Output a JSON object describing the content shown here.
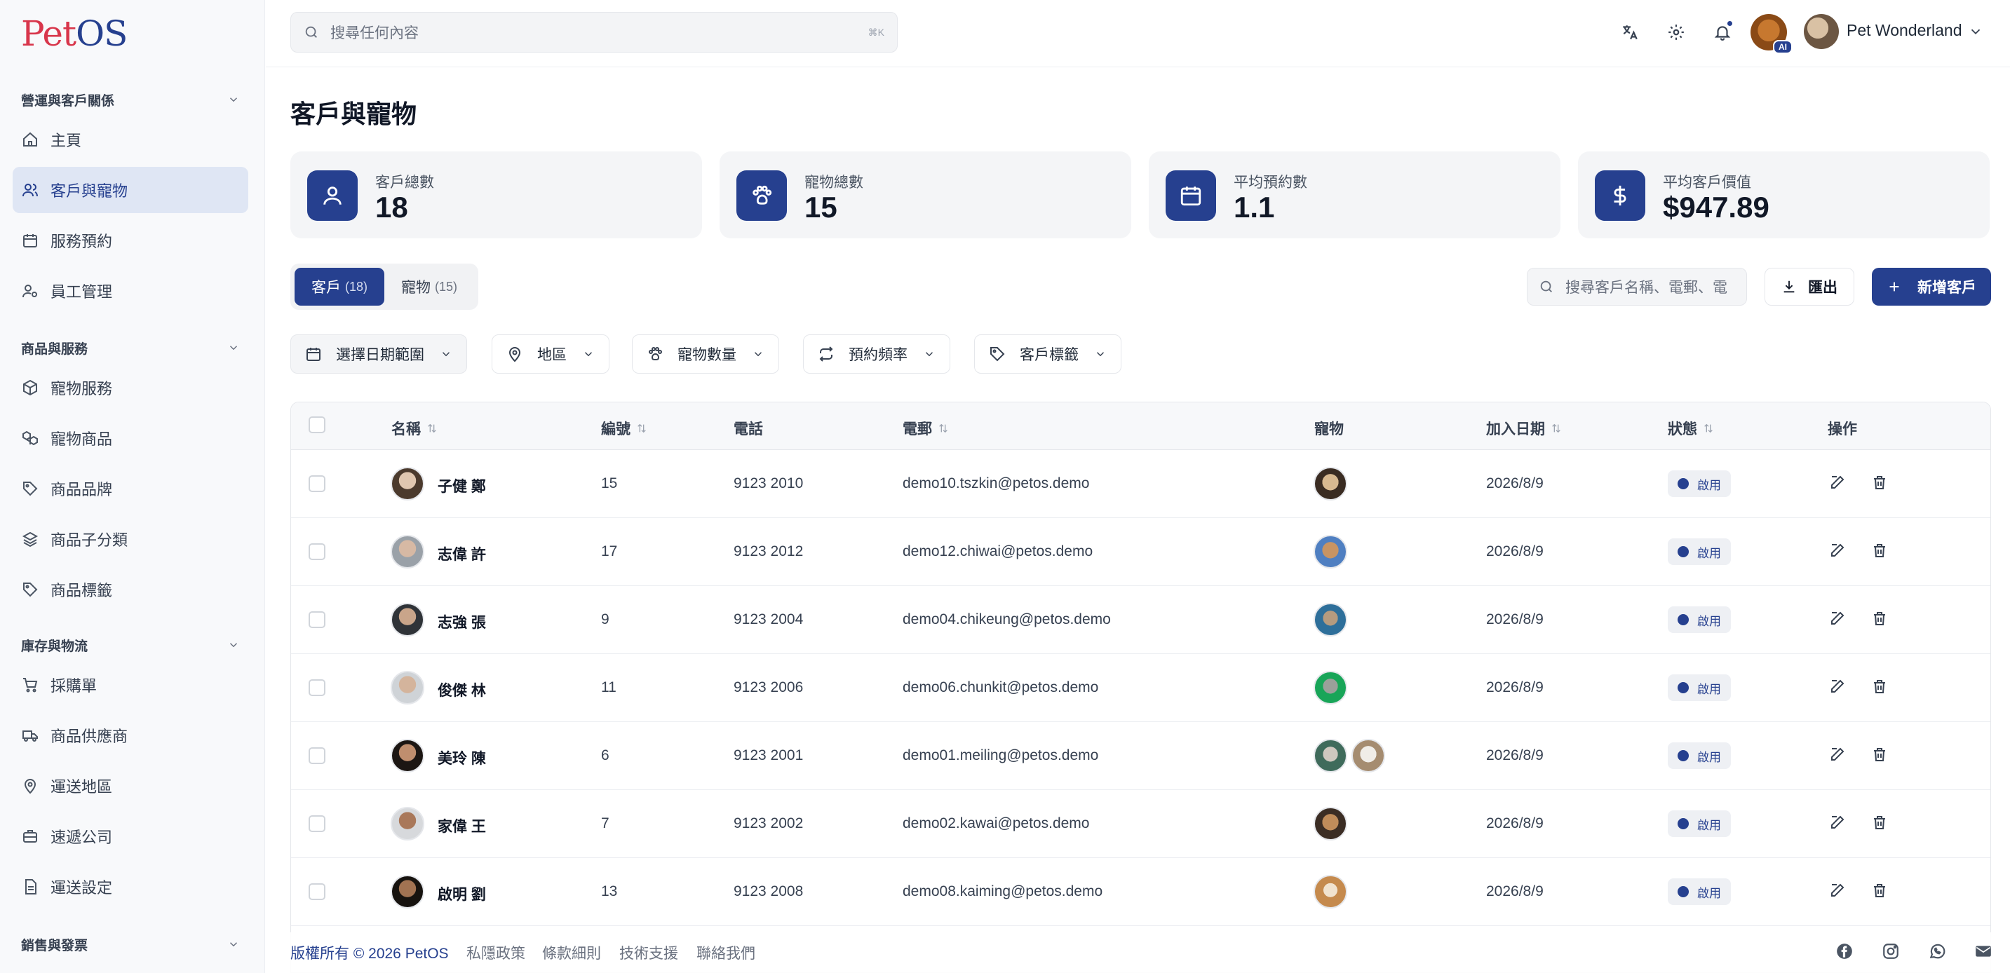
{
  "app": {
    "logo_pet": "Pet",
    "logo_os": "OS"
  },
  "sidebar": {
    "groups": [
      {
        "label": "營運與客戶關係",
        "items": [
          {
            "label": "主頁",
            "icon": "home-icon"
          },
          {
            "label": "客戶與寵物",
            "icon": "users-icon",
            "active": true
          },
          {
            "label": "服務預約",
            "icon": "calendar-icon"
          },
          {
            "label": "員工管理",
            "icon": "user-cog-icon"
          }
        ]
      },
      {
        "label": "商品與服務",
        "items": [
          {
            "label": "寵物服務",
            "icon": "package-icon"
          },
          {
            "label": "寵物商品",
            "icon": "boxes-icon"
          },
          {
            "label": "商品品牌",
            "icon": "tag-icon"
          },
          {
            "label": "商品子分類",
            "icon": "layers-icon"
          },
          {
            "label": "商品標籤",
            "icon": "tags-icon"
          }
        ]
      },
      {
        "label": "庫存與物流",
        "items": [
          {
            "label": "採購單",
            "icon": "cart-icon"
          },
          {
            "label": "商品供應商",
            "icon": "truck-icon"
          },
          {
            "label": "運送地區",
            "icon": "map-pin-icon"
          },
          {
            "label": "速遞公司",
            "icon": "briefcase-icon"
          },
          {
            "label": "運送設定",
            "icon": "file-settings-icon"
          }
        ]
      },
      {
        "label": "銷售與發票",
        "items": []
      }
    ]
  },
  "topbar": {
    "search_placeholder": "搜尋任何內容",
    "search_shortcut": "⌘K",
    "ai_badge": "AI",
    "user_name": "Pet Wonderland"
  },
  "page": {
    "title": "客戶與寵物"
  },
  "stats": [
    {
      "label": "客戶總數",
      "value": "18",
      "icon": "user-icon"
    },
    {
      "label": "寵物總數",
      "value": "15",
      "icon": "paw-icon"
    },
    {
      "label": "平均預約數",
      "value": "1.1",
      "icon": "calendar-icon"
    },
    {
      "label": "平均客戶價值",
      "value": "$947.89",
      "icon": "dollar-icon"
    }
  ],
  "tabs": [
    {
      "label": "客戶",
      "count": "(18)",
      "active": true
    },
    {
      "label": "寵物",
      "count": "(15)",
      "active": false
    }
  ],
  "customer_search_placeholder": "搜尋客戶名稱、電郵、電",
  "buttons": {
    "export": "匯出",
    "add_customer": "新增客戶"
  },
  "filters": [
    {
      "label": "選擇日期範圍",
      "icon": "calendar-icon"
    },
    {
      "label": "地區",
      "icon": "map-pin-icon"
    },
    {
      "label": "寵物數量",
      "icon": "paw-icon"
    },
    {
      "label": "預約頻率",
      "icon": "repeat-icon"
    },
    {
      "label": "客戶標籤",
      "icon": "tag-icon"
    }
  ],
  "table": {
    "headers": {
      "name": "名稱",
      "id": "編號",
      "phone": "電話",
      "email": "電郵",
      "pets": "寵物",
      "joined": "加入日期",
      "status": "狀態",
      "actions": "操作"
    },
    "rows": [
      {
        "name": "子健 鄭",
        "id": "15",
        "phone": "9123 2010",
        "email": "demo10.tszkin@petos.demo",
        "joined": "2026/8/9",
        "status": "啟用",
        "pets": 1
      },
      {
        "name": "志偉 許",
        "id": "17",
        "phone": "9123 2012",
        "email": "demo12.chiwai@petos.demo",
        "joined": "2026/8/9",
        "status": "啟用",
        "pets": 1
      },
      {
        "name": "志強 張",
        "id": "9",
        "phone": "9123 2004",
        "email": "demo04.chikeung@petos.demo",
        "joined": "2026/8/9",
        "status": "啟用",
        "pets": 1
      },
      {
        "name": "俊傑 林",
        "id": "11",
        "phone": "9123 2006",
        "email": "demo06.chunkit@petos.demo",
        "joined": "2026/8/9",
        "status": "啟用",
        "pets": 1
      },
      {
        "name": "美玲 陳",
        "id": "6",
        "phone": "9123 2001",
        "email": "demo01.meiling@petos.demo",
        "joined": "2026/8/9",
        "status": "啟用",
        "pets": 2
      },
      {
        "name": "家偉 王",
        "id": "7",
        "phone": "9123 2002",
        "email": "demo02.kawai@petos.demo",
        "joined": "2026/8/9",
        "status": "啟用",
        "pets": 1
      },
      {
        "name": "啟明 劉",
        "id": "13",
        "phone": "9123 2008",
        "email": "demo08.kaiming@petos.demo",
        "joined": "2026/8/9",
        "status": "啟用",
        "pets": 1
      }
    ]
  },
  "footer": {
    "copyright": "版權所有 © 2026 PetOS",
    "links": [
      "私隱政策",
      "條款細則",
      "技術支援",
      "聯絡我們"
    ],
    "social": [
      "facebook-icon",
      "instagram-icon",
      "whatsapp-icon",
      "mail-icon"
    ]
  },
  "colors": {
    "brand": "#26408f",
    "logo_red": "#d8364b",
    "active_bg": "#dfe6f4"
  }
}
